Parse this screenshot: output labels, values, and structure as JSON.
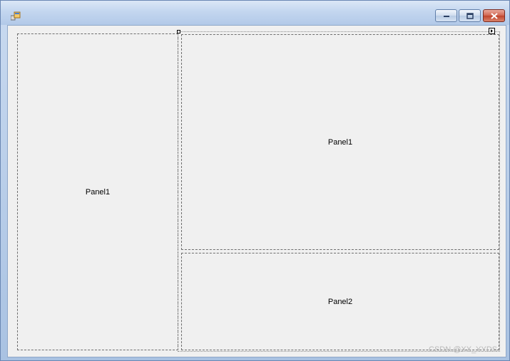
{
  "window": {
    "controls": {
      "minimize_icon": "minimize-icon",
      "maximize_icon": "maximize-icon",
      "close_icon": "close-icon"
    }
  },
  "designer": {
    "left_panel": {
      "label": "Panel1"
    },
    "right_split": {
      "top_panel": {
        "label": "Panel1"
      },
      "bottom_panel": {
        "label": "Panel2"
      }
    }
  },
  "watermark": {
    "text": "CSDN @XX_YYDS"
  }
}
